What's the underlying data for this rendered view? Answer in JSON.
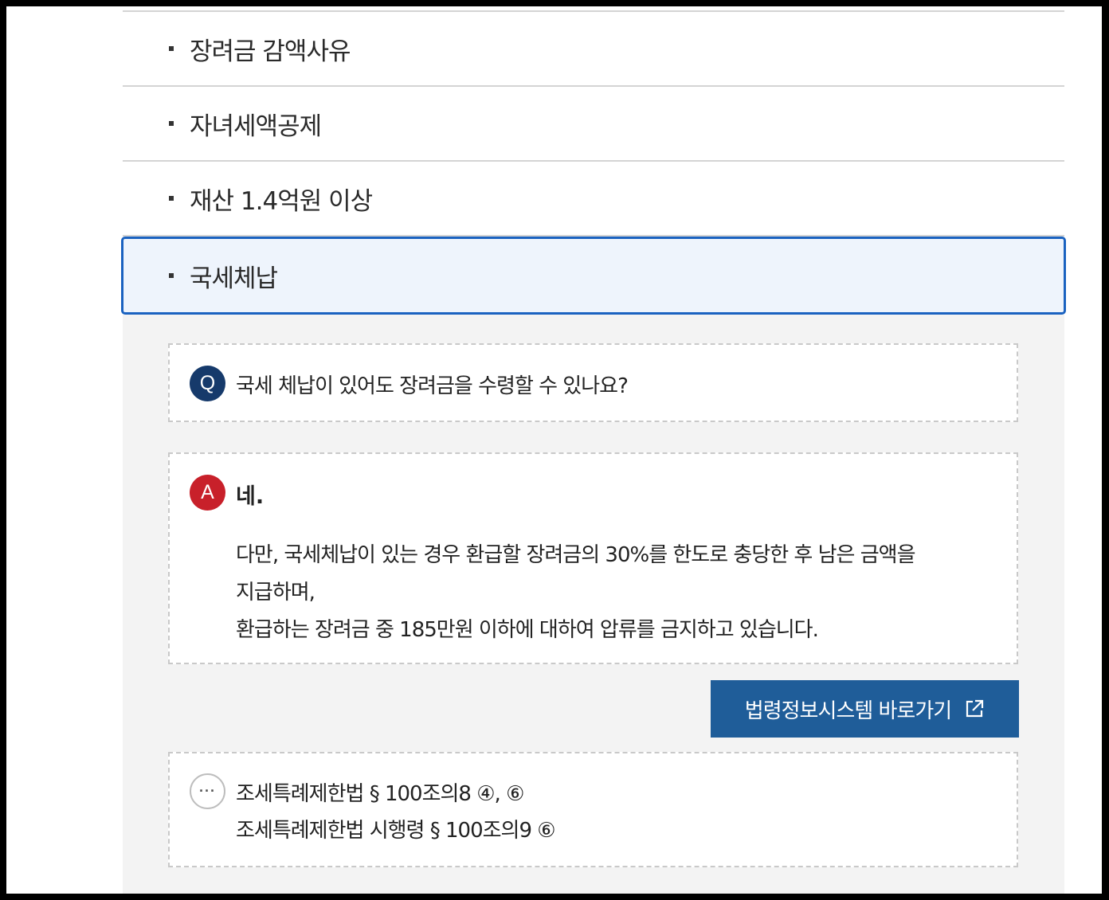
{
  "accordion": {
    "items": [
      {
        "title": "장려금 감액사유"
      },
      {
        "title": "자녀세액공제"
      },
      {
        "title": "재산 1.4억원 이상"
      },
      {
        "title": "국세체납"
      }
    ]
  },
  "qa": {
    "question_badge": "Q",
    "question": "국세 체납이 있어도 장려금을 수령할 수 있나요?",
    "answer_badge": "A",
    "answer_head": "네.",
    "answer_lines": [
      "다만, 국세체납이 있는 경우 환급할 장려금의 30%를 한도로 충당한 후 남은 금액을",
      "지급하며,",
      "환급하는 장려금 중 185만원 이하에 대하여 압류를 금지하고 있습니다."
    ]
  },
  "law_button": {
    "label": "법령정보시스템 바로가기",
    "icon": "external-link-icon"
  },
  "references": {
    "icon": "more-icon",
    "icon_glyph": "···",
    "lines": [
      "조세특례제한법 § 100조의8 ④, ⑥",
      "조세특례제한법 시행령 § 100조의9 ⑥"
    ]
  },
  "colors": {
    "active_border": "#1a62c0",
    "active_bg": "#eef4fc",
    "q_badge": "#163a6b",
    "a_badge": "#c8202a",
    "button": "#1f5d99"
  }
}
